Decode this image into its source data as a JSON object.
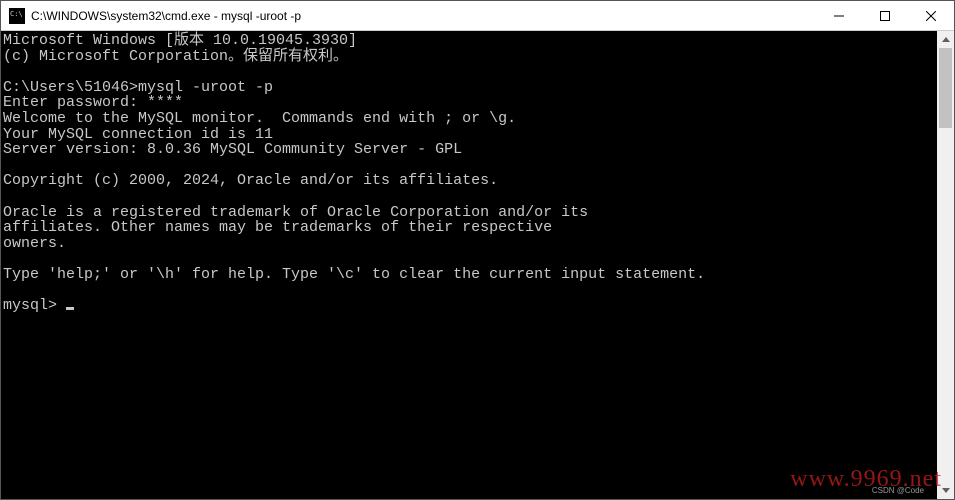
{
  "window": {
    "title": "C:\\WINDOWS\\system32\\cmd.exe - mysql  -uroot -p"
  },
  "terminal": {
    "lines": [
      "Microsoft Windows [版本 10.0.19045.3930]",
      "(c) Microsoft Corporation。保留所有权利。",
      "",
      "C:\\Users\\51046>mysql -uroot -p",
      "Enter password: ****",
      "Welcome to the MySQL monitor.  Commands end with ; or \\g.",
      "Your MySQL connection id is 11",
      "Server version: 8.0.36 MySQL Community Server - GPL",
      "",
      "Copyright (c) 2000, 2024, Oracle and/or its affiliates.",
      "",
      "Oracle is a registered trademark of Oracle Corporation and/or its",
      "affiliates. Other names may be trademarks of their respective",
      "owners.",
      "",
      "Type 'help;' or '\\h' for help. Type '\\c' to clear the current input statement.",
      ""
    ],
    "prompt": "mysql> "
  },
  "watermark": {
    "main": "www.9969.net",
    "sub": "CSDN @Code"
  }
}
